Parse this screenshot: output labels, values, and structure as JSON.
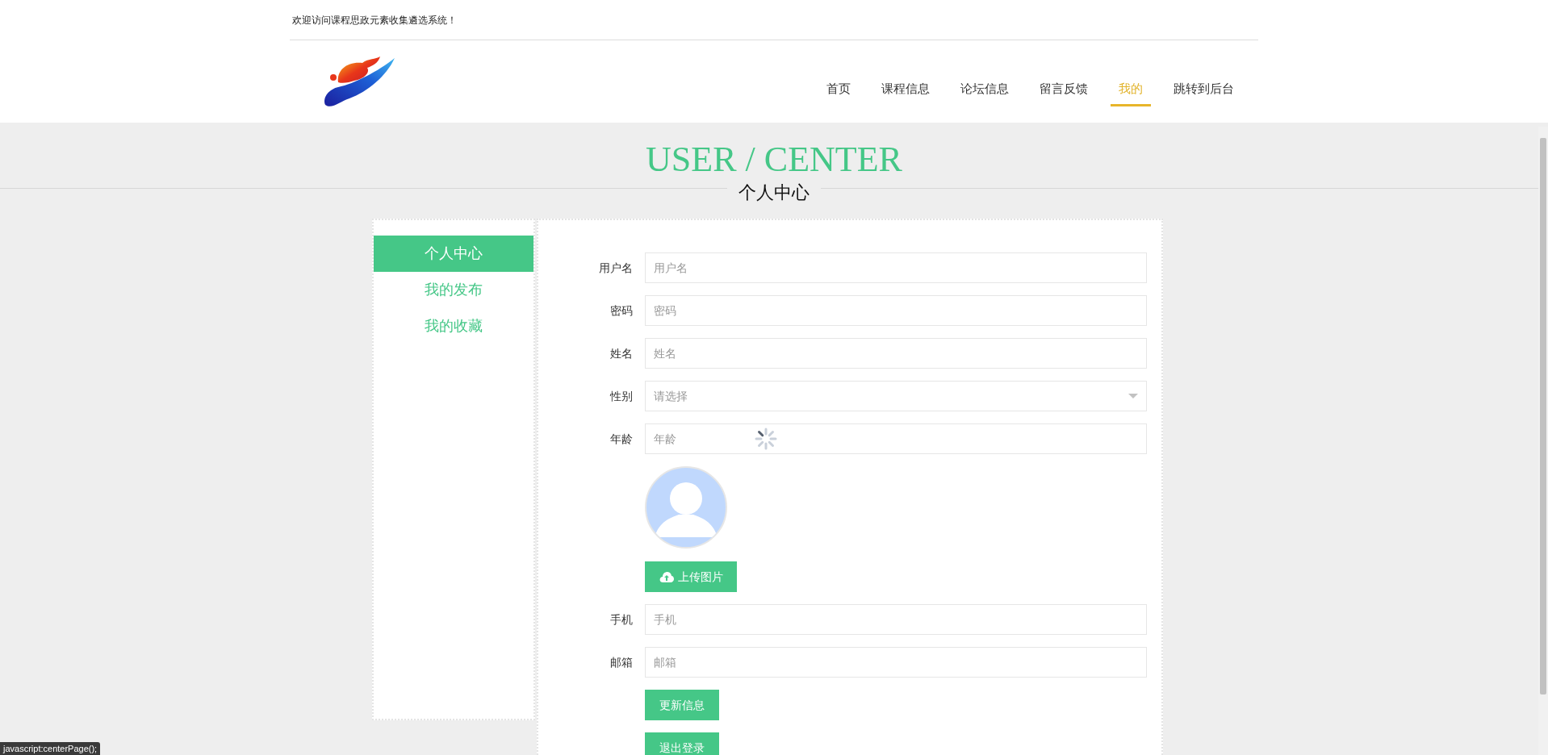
{
  "welcome": "欢迎访问课程思政元素收集遴选系统！",
  "nav": [
    {
      "label": "首页",
      "selected": false
    },
    {
      "label": "课程信息",
      "selected": false
    },
    {
      "label": "论坛信息",
      "selected": false
    },
    {
      "label": "留言反馈",
      "selected": false
    },
    {
      "label": "我的",
      "selected": true
    },
    {
      "label": "跳转到后台",
      "selected": false
    }
  ],
  "page_title": "USER / CENTER",
  "page_subtitle": "个人中心",
  "sidebar": [
    {
      "label": "个人中心",
      "selected": true
    },
    {
      "label": "我的发布",
      "selected": false
    },
    {
      "label": "我的收藏",
      "selected": false
    }
  ],
  "form": {
    "fields": [
      {
        "kind": "text",
        "label": "用户名",
        "placeholder": "用户名"
      },
      {
        "kind": "text",
        "label": "密码",
        "placeholder": "密码"
      },
      {
        "kind": "text",
        "label": "姓名",
        "placeholder": "姓名"
      },
      {
        "kind": "select",
        "label": "性别",
        "placeholder": "请选择"
      },
      {
        "kind": "text",
        "label": "年龄",
        "placeholder": "年龄",
        "loading": true
      },
      {
        "kind": "image",
        "button": "上传图片"
      },
      {
        "kind": "text",
        "label": "手机",
        "placeholder": "手机"
      },
      {
        "kind": "text",
        "label": "邮箱",
        "placeholder": "邮箱"
      }
    ],
    "buttons": [
      "更新信息",
      "退出登录"
    ]
  },
  "status_bar": "javascript:centerPage();"
}
